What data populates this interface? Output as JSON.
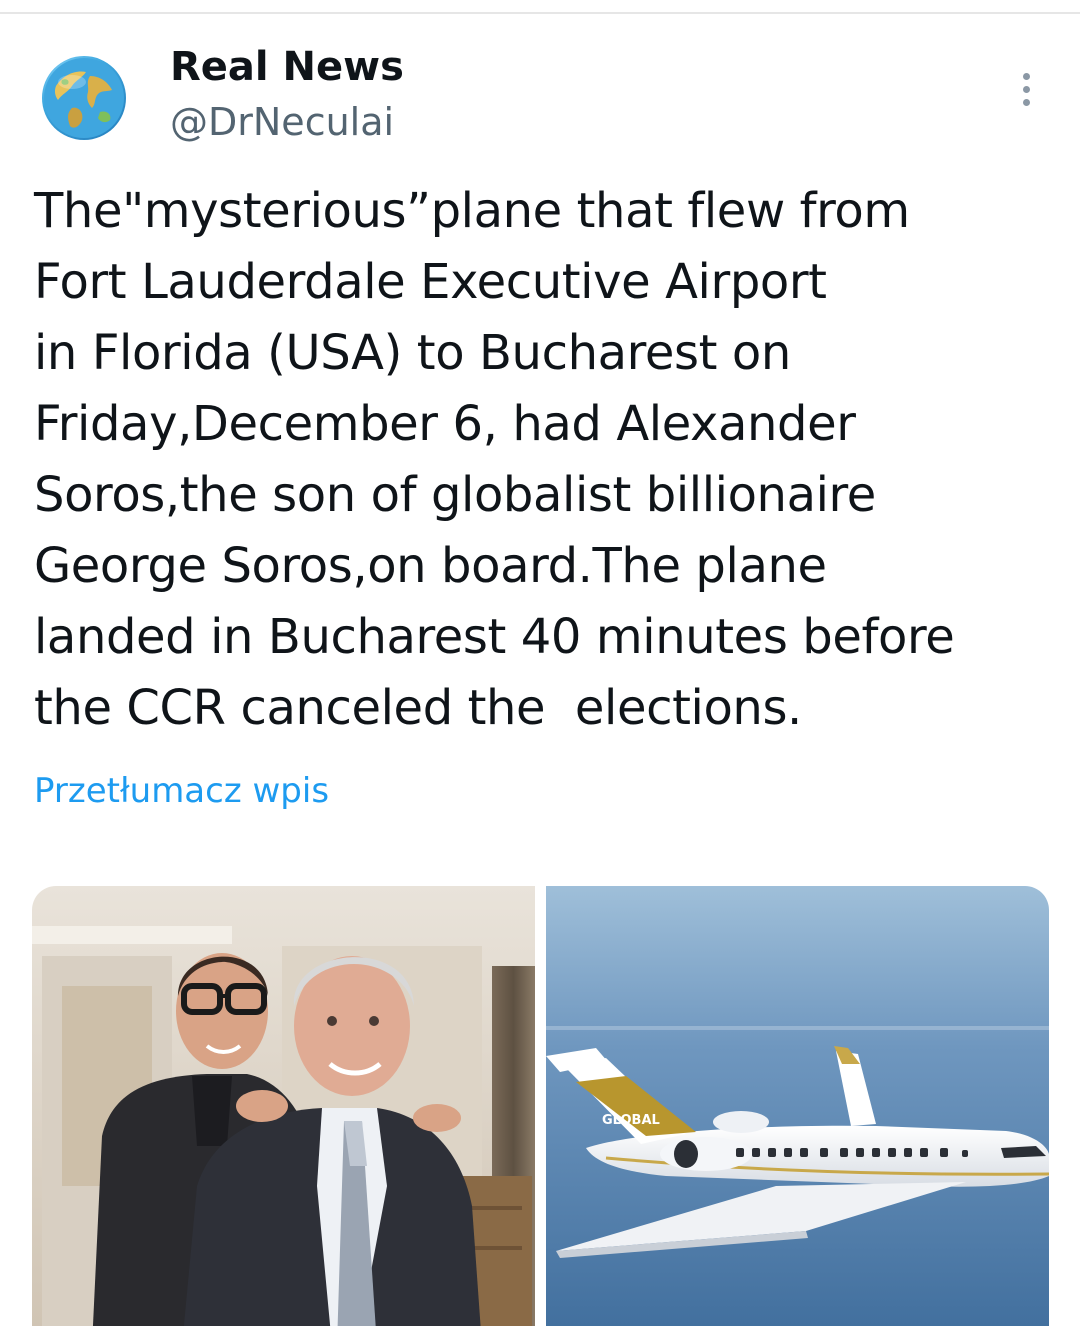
{
  "tweet": {
    "author": {
      "display_name": "Real News",
      "handle": "@DrNeculai",
      "avatar_icon": "globe-avatar"
    },
    "more_icon": "more-vertical-icon",
    "text": "The\"mysterious”plane that flew from\nFort Lauderdale Executive Airport\nin Florida (USA) to Bucharest on\nFriday,December 6, had Alexander\nSoros,the son of globalist billionaire\nGeorge Soros,on board.The plane\nlanded in Bucharest 40 minutes before\nthe CCR canceled the  elections.",
    "translate_label": "Przetłumacz wpis",
    "media": [
      {
        "kind": "photo"
      },
      {
        "kind": "photo",
        "tail_text": "GLOBAL"
      }
    ]
  },
  "colors": {
    "text_primary": "#0f1419",
    "text_secondary": "#536471",
    "link": "#1d9bf0",
    "divider": "#e6e6e6"
  }
}
